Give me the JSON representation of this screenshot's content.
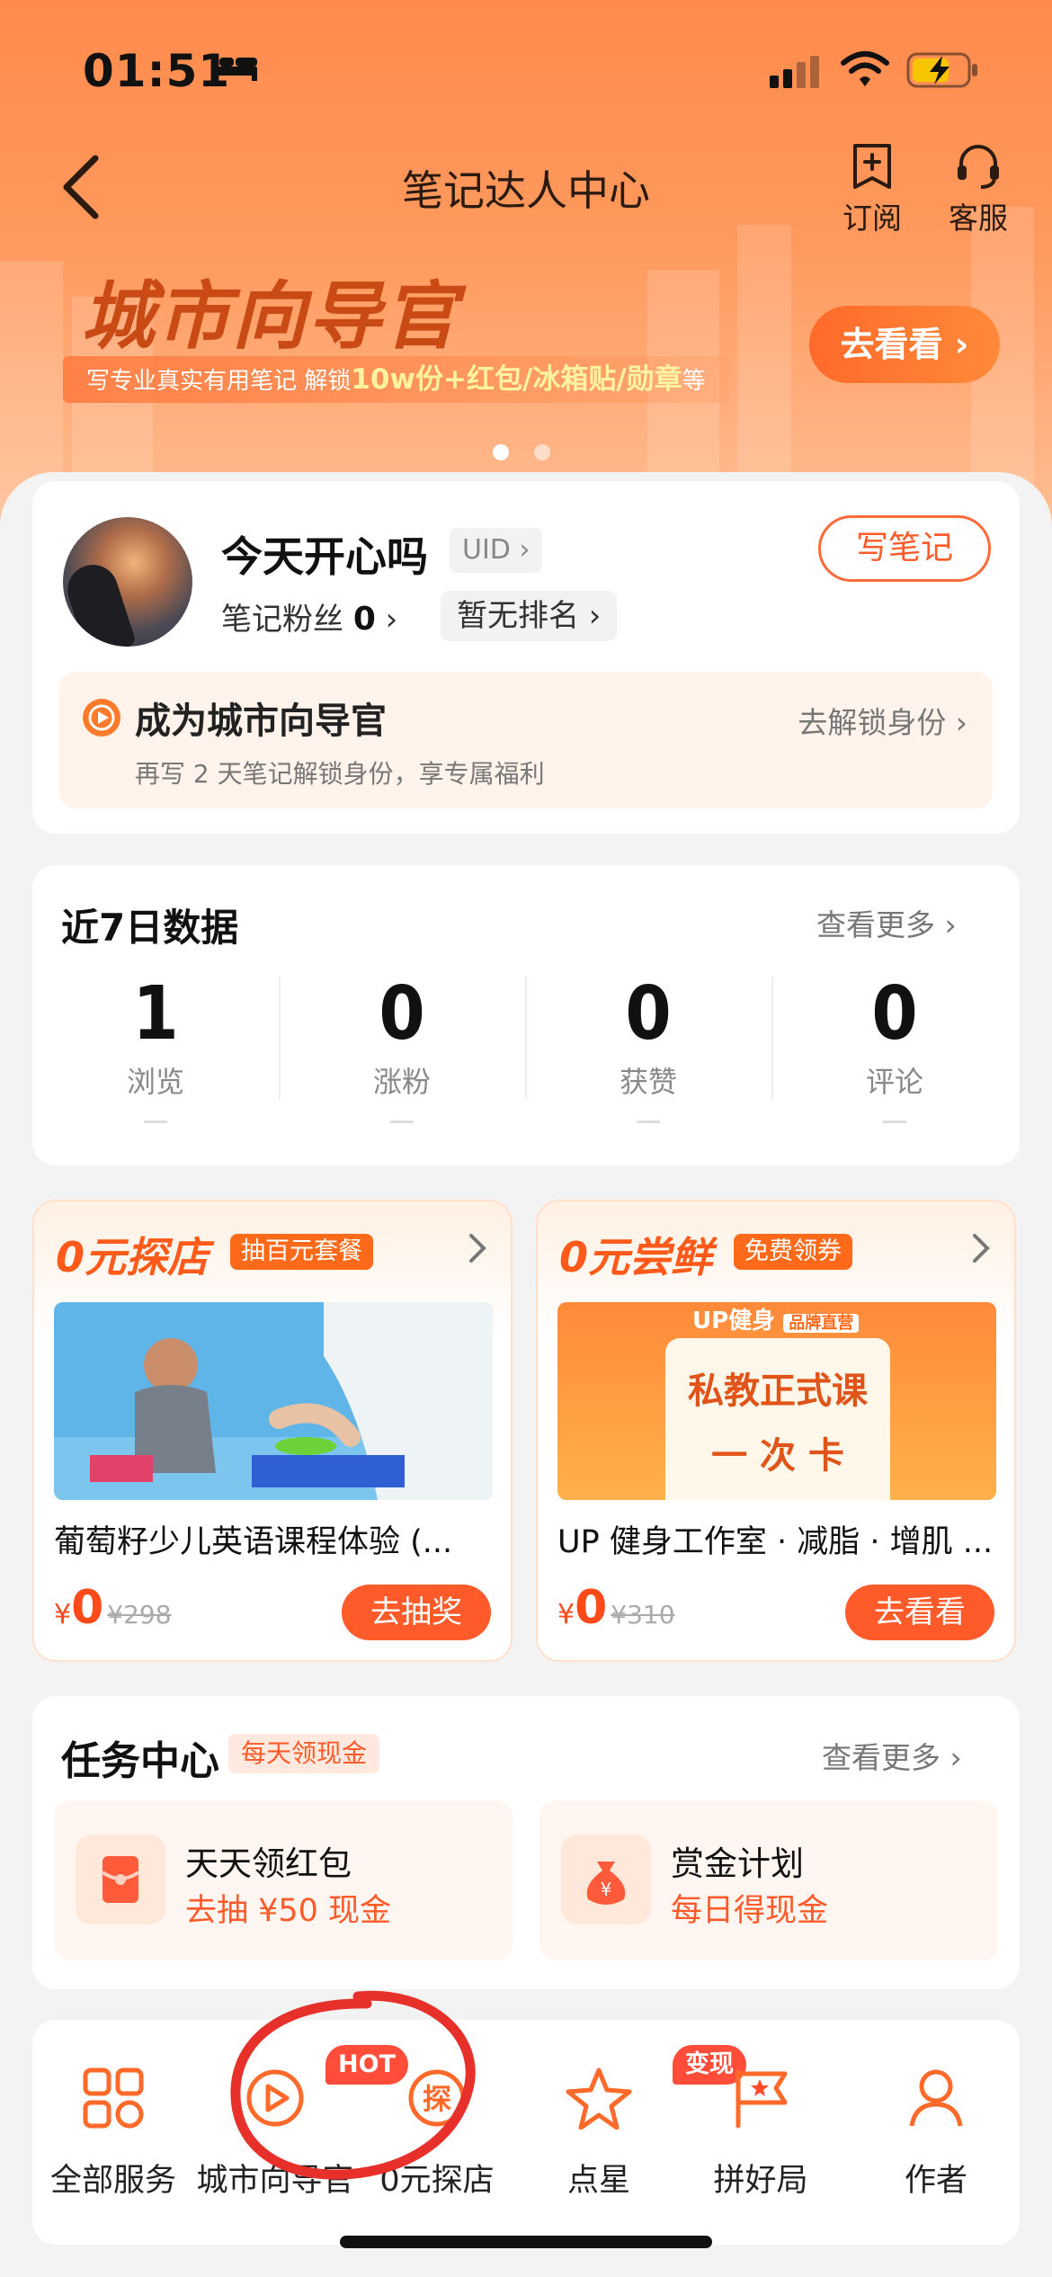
{
  "status": {
    "time": "01:51"
  },
  "nav": {
    "title": "笔记达人中心",
    "subscribe": "订阅",
    "service": "客服"
  },
  "banner": {
    "title": "城市向导官",
    "sub_prefix": "写专业真实有用笔记 解锁",
    "sub_highlight": "10w份+红包/冰箱贴/勋章",
    "sub_suffix": "等",
    "button": "去看看",
    "page_count": 2,
    "active_page": 1
  },
  "profile": {
    "name": "今天开心吗",
    "uid": "UID",
    "write_button": "写笔记",
    "fans_label": "笔记粉丝",
    "fans_count": "0",
    "rank": "暂无排名",
    "guide_title": "成为城市向导官",
    "guide_link": "去解锁身份",
    "guide_sub": "再写 2 天笔记解锁身份，享专属福利"
  },
  "stats": {
    "title": "近7日数据",
    "more": "查看更多",
    "items": [
      {
        "value": "1",
        "label": "浏览"
      },
      {
        "value": "0",
        "label": "涨粉"
      },
      {
        "value": "0",
        "label": "获赞"
      },
      {
        "value": "0",
        "label": "评论"
      }
    ]
  },
  "offers": [
    {
      "brand": "0元探店",
      "tag": "抽百元套餐",
      "name": "葡萄籽少儿英语课程体验 (...",
      "currency": "¥",
      "price": "0",
      "original": "¥298",
      "button": "去抽奖"
    },
    {
      "brand": "0元尝鲜",
      "tag": "免费领券",
      "name": "UP 健身工作室 · 减脂 · 增肌 ...",
      "currency": "¥",
      "price": "0",
      "original": "¥310",
      "button": "去看看",
      "pic_top": "UP健身",
      "pic_badge": "品牌直营",
      "pic_line1": "私教正式课",
      "pic_line2": "一 次 卡"
    }
  ],
  "tasks": {
    "title": "任务中心",
    "tag": "每天领现金",
    "more": "查看更多",
    "items": [
      {
        "title": "天天领红包",
        "sub": "去抽 ¥50 现金"
      },
      {
        "title": "赏金计划",
        "sub": "每日得现金"
      }
    ]
  },
  "services": {
    "items": [
      {
        "label": "全部服务",
        "icon": "grid-icon"
      },
      {
        "label": "城市向导官",
        "icon": "play-circle-icon",
        "badge": "HOT"
      },
      {
        "label": "0元探店",
        "icon": "explore-icon"
      },
      {
        "label": "点星",
        "icon": "star-icon",
        "badge": "变现"
      },
      {
        "label": "拼好局",
        "icon": "flag-icon"
      },
      {
        "label": "作者",
        "icon": "person-icon"
      }
    ]
  },
  "colors": {
    "accent": "#ff5a2a",
    "annotation": "#e8302a",
    "hero_top": "#ff8a4c"
  }
}
